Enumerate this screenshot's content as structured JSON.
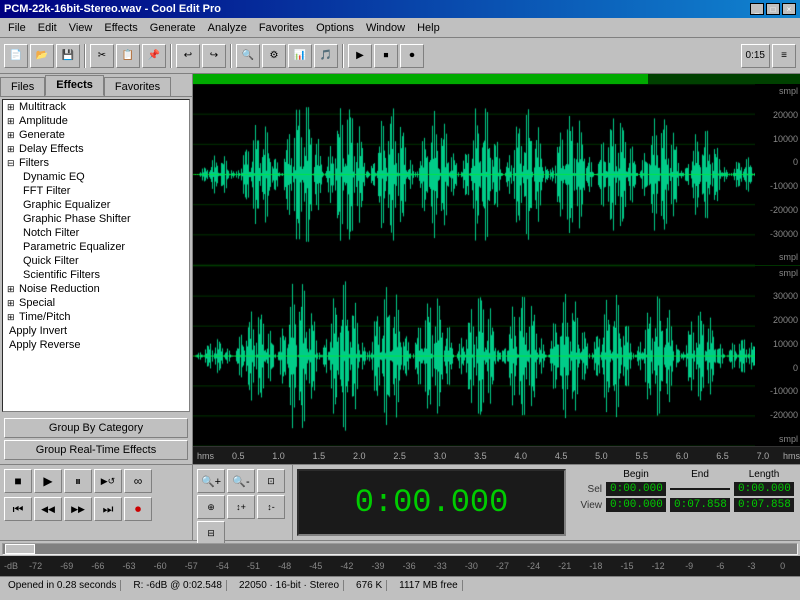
{
  "titleBar": {
    "title": "PCM-22k-16bit-Stereo.wav - Cool Edit Pro",
    "buttons": [
      "_",
      "□",
      "×"
    ]
  },
  "menuBar": {
    "items": [
      "File",
      "Edit",
      "View",
      "Effects",
      "Generate",
      "Analyze",
      "Favorites",
      "Options",
      "Window",
      "Help"
    ]
  },
  "tabs": {
    "files": "Files",
    "effects": "Effects",
    "favorites": "Favorites",
    "active": "Effects"
  },
  "treeItems": [
    {
      "id": "multitrack",
      "label": "Multitrack",
      "type": "parent",
      "expanded": false
    },
    {
      "id": "amplitude",
      "label": "Amplitude",
      "type": "parent",
      "expanded": false
    },
    {
      "id": "generate",
      "label": "Generate",
      "type": "parent",
      "expanded": false
    },
    {
      "id": "delay-effects",
      "label": "Delay Effects",
      "type": "parent",
      "expanded": false
    },
    {
      "id": "filters",
      "label": "Filters",
      "type": "parent",
      "expanded": true
    },
    {
      "id": "dynamic-eq",
      "label": "Dynamic EQ",
      "type": "child"
    },
    {
      "id": "fft-filter",
      "label": "FFT Filter",
      "type": "child"
    },
    {
      "id": "graphic-equalizer",
      "label": "Graphic Equalizer",
      "type": "child"
    },
    {
      "id": "graphic-phase-shifter",
      "label": "Graphic Phase Shifter",
      "type": "child"
    },
    {
      "id": "notch-filter",
      "label": "Notch Filter",
      "type": "child"
    },
    {
      "id": "parametric-equalizer",
      "label": "Parametric Equalizer",
      "type": "child"
    },
    {
      "id": "quick-filter",
      "label": "Quick Filter",
      "type": "child"
    },
    {
      "id": "scientific-filters",
      "label": "Scientific Filters",
      "type": "child"
    },
    {
      "id": "noise-reduction",
      "label": "Noise Reduction",
      "type": "parent",
      "expanded": false
    },
    {
      "id": "special",
      "label": "Special",
      "type": "parent",
      "expanded": false
    },
    {
      "id": "time-pitch",
      "label": "Time/Pitch",
      "type": "parent",
      "expanded": false
    },
    {
      "id": "apply-invert",
      "label": "Apply Invert",
      "type": "top"
    },
    {
      "id": "apply-reverse",
      "label": "Apply Reverse",
      "type": "top"
    }
  ],
  "panelButtons": {
    "groupByCategory": "Group By Category",
    "groupRealTime": "Group Real-Time Effects"
  },
  "waveform": {
    "progressWidth": "75%",
    "timeRuler": [
      "hms",
      "0.5",
      "1.0",
      "1.5",
      "2.0",
      "2.5",
      "3.0",
      "3.5",
      "4.0",
      "4.5",
      "5.0",
      "5.5",
      "6.0",
      "6.5",
      "7.0",
      "hms"
    ],
    "yAxis1": [
      "smpl",
      "20000",
      "10000",
      "0",
      "-10000",
      "-20000",
      "-30000",
      "smpl"
    ],
    "yAxis2": [
      "smpl",
      "30000",
      "20000",
      "10000",
      "0",
      "-10000",
      "-20000",
      "smpl"
    ]
  },
  "transport": {
    "buttons": [
      {
        "id": "stop",
        "symbol": "■"
      },
      {
        "id": "play",
        "symbol": "▶"
      },
      {
        "id": "pause",
        "symbol": "⏸"
      },
      {
        "id": "play-loop",
        "symbol": "↺"
      },
      {
        "id": "loop",
        "symbol": "⟳"
      },
      {
        "id": "rewind",
        "symbol": "⏮"
      },
      {
        "id": "back",
        "symbol": "◀◀"
      },
      {
        "id": "forward",
        "symbol": "▶▶"
      },
      {
        "id": "end",
        "symbol": "⏭"
      },
      {
        "id": "record",
        "symbol": "⏺",
        "red": true
      }
    ],
    "timeDisplay": "0:00.000"
  },
  "timeInfo": {
    "headers": [
      "Begin",
      "End",
      "Length"
    ],
    "sel": {
      "label": "Sel",
      "begin": "0:00.000",
      "end": "",
      "length": "0:00.000"
    },
    "view": {
      "label": "View",
      "begin": "0:00.000",
      "end": "0:07.858",
      "length": "0:07.858"
    }
  },
  "statusBar": {
    "openedIn": "Opened in 0.28 seconds",
    "level": "R: -6dB @  0:02.548",
    "sampleRate": "22050 · 16-bit · Stereo",
    "fileSize": "676 K",
    "freeSpace": "1117 MB free"
  },
  "scaleBar": {
    "ticks": [
      "-dB",
      "-72",
      "-69",
      "-66",
      "-63",
      "-60",
      "-57",
      "-54",
      "-51",
      "-48",
      "-45",
      "-42",
      "-39",
      "-36",
      "-33",
      "-30",
      "-27",
      "-24",
      "-21",
      "-18",
      "-15",
      "-12",
      "-9",
      "-6",
      "-3",
      "0"
    ]
  }
}
